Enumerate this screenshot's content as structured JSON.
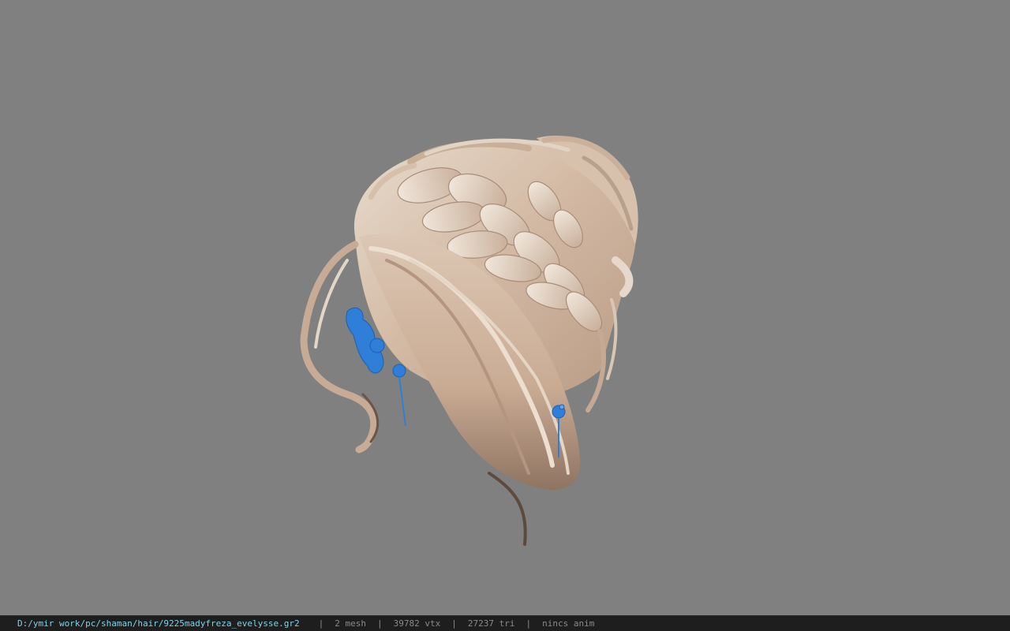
{
  "viewport": {
    "background_color": "#808080",
    "model": {
      "subject": "hair-mesh",
      "hair_colors": [
        "#d9c3b0",
        "#c8ab95",
        "#e8dccd",
        "#9a7f6c",
        "#5e4a3d"
      ],
      "accessory_color": "#2f7fd8"
    }
  },
  "status_bar": {
    "file_path": "D:/ymir work/pc/shaman/hair/9225madyfreza_evelysse.gr2",
    "separator": "|",
    "mesh_count": "2 mesh",
    "vertex_count": "39782 vtx",
    "triangle_count": "27237 tri",
    "animation": "nincs anim",
    "colors": {
      "path_text": "#7fd2ea",
      "stat_text": "#8a8a8a",
      "bar_background": "#1e1e1e"
    }
  }
}
